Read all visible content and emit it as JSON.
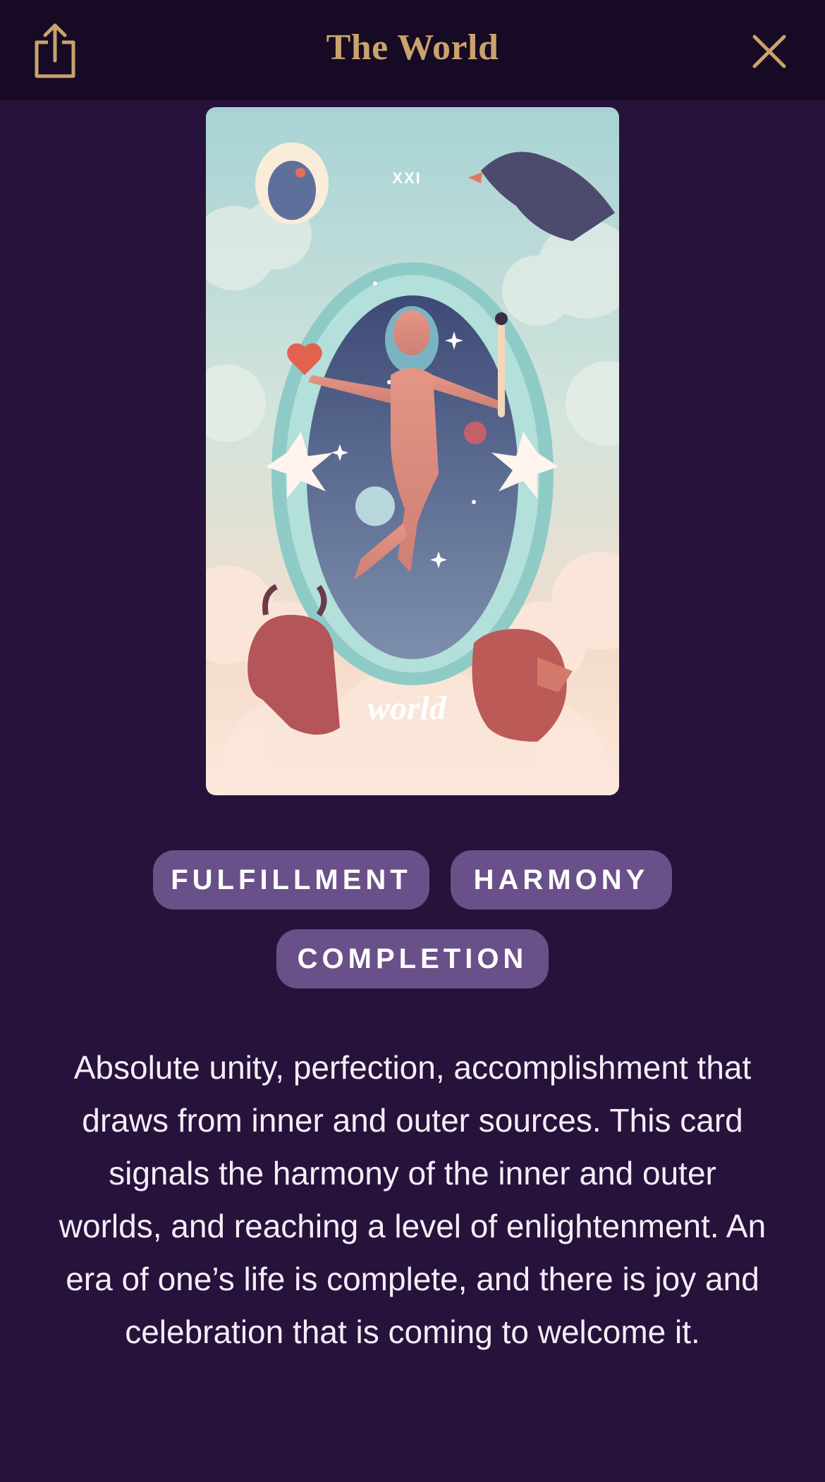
{
  "header": {
    "title": "The World",
    "share_icon": "share-icon",
    "close_icon": "close-icon"
  },
  "card": {
    "numeral": "XXI",
    "name": "world"
  },
  "tags": [
    "FULFILLMENT",
    "HARMONY",
    "COMPLETION"
  ],
  "description": "Absolute unity, perfection, accomplishment that draws from inner and outer sources. This card signals the harmony of the inner and outer worlds, and reaching a level of enlightenment. An era of one’s life is complete, and there is joy and celebration that is coming to welcome it.",
  "colors": {
    "background": "#26123a",
    "header_bg": "#170a24",
    "accent_gold": "#c9a36c",
    "tag_bg": "#6a5089",
    "text": "#f4eef8"
  }
}
